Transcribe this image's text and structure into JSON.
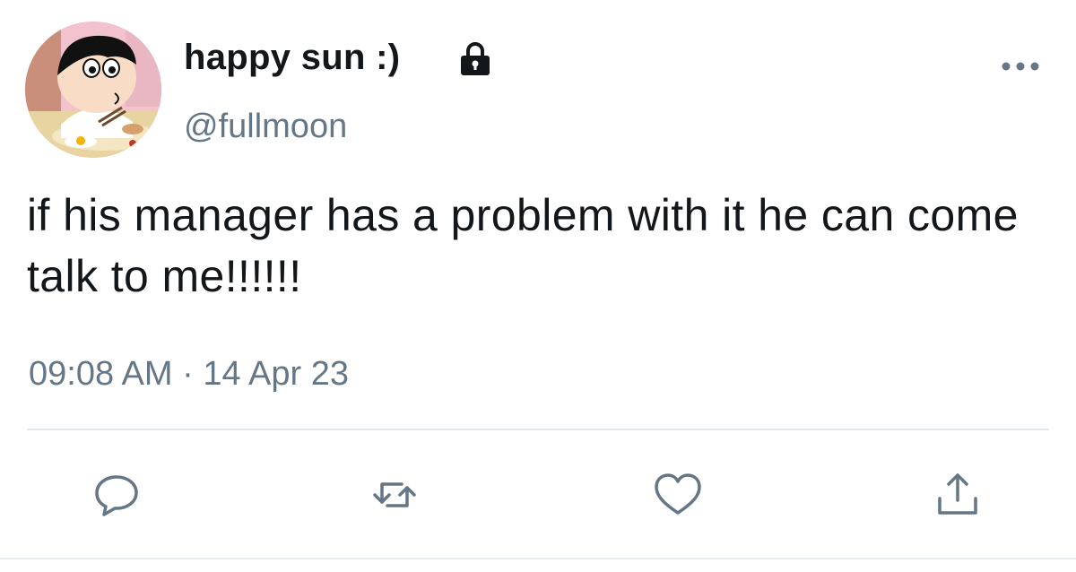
{
  "user": {
    "display_name": "happy sun :)",
    "handle": "@fullmoon",
    "avatar_icon": "cartoon-avatar",
    "protected_icon": "lock-icon"
  },
  "tweet": {
    "text": "if his manager has a problem with it he can come talk to me!!!!!!",
    "timestamp": "09:08 AM · 14 Apr 23"
  },
  "actions": {
    "more_icon": "more-icon",
    "reply_icon": "reply-icon",
    "retweet_icon": "retweet-icon",
    "like_icon": "heart-icon",
    "share_icon": "share-icon"
  },
  "colors": {
    "text": "#14171a",
    "secondary": "#657786",
    "divider": "#e1e8ed"
  }
}
